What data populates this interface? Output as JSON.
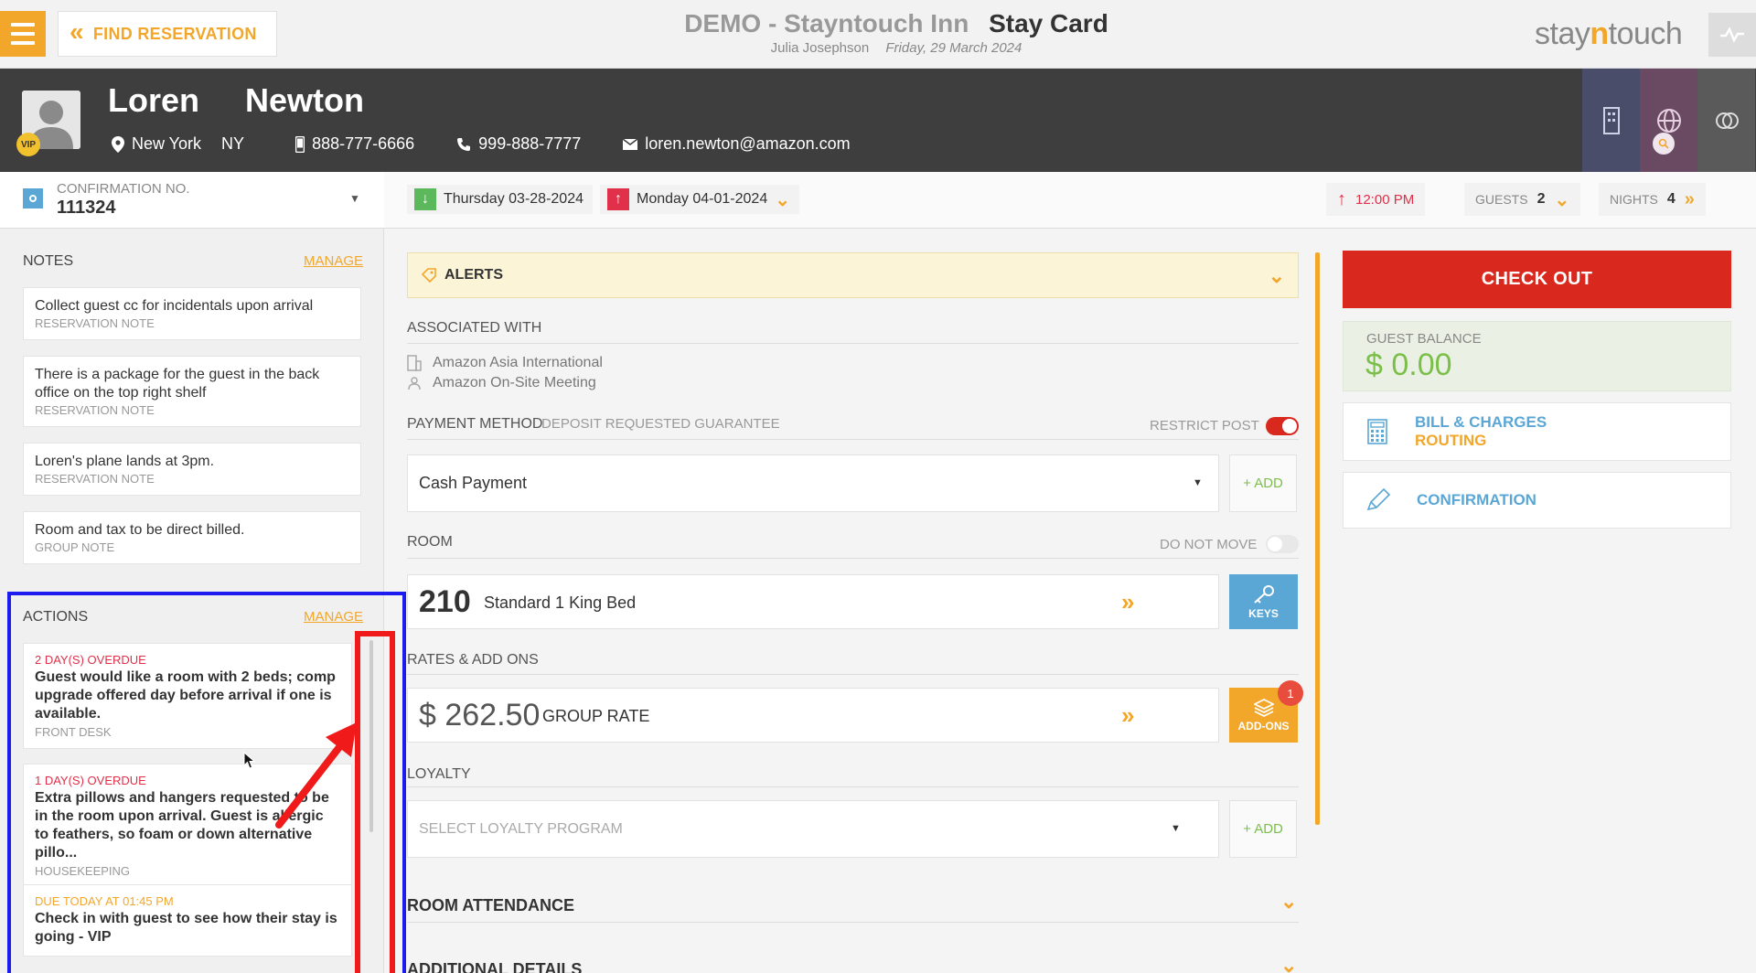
{
  "topbar": {
    "find_label": "FIND RESERVATION",
    "hotel_name": "DEMO - Stayntouch Inn",
    "page_title": "Stay Card",
    "user_name": "Julia Josephson",
    "business_date": "Friday, 29 March 2024",
    "logo_prefix": "stay",
    "logo_n": "n",
    "logo_suffix": "touch"
  },
  "guest": {
    "first_name": "Loren",
    "last_name": "Newton",
    "vip_label": "VIP",
    "city": "New York",
    "state": "NY",
    "mobile": "888-777-6666",
    "phone": "999-888-7777",
    "email": "loren.newton@amazon.com"
  },
  "reservation": {
    "confirmation_label": "CONFIRMATION NO.",
    "confirmation_number": "111324",
    "arrival": "Thursday 03-28-2024",
    "departure": "Monday 04-01-2024",
    "departure_time": "12:00 PM",
    "guests_label": "GUESTS",
    "guests": "2",
    "nights_label": "NIGHTS",
    "nights": "4"
  },
  "notes": {
    "title": "NOTES",
    "manage": "MANAGE",
    "items": [
      {
        "text": "Collect guest cc for incidentals upon arrival",
        "type": "RESERVATION NOTE"
      },
      {
        "text": "There is a package for the guest in the back office on the top right shelf",
        "type": "RESERVATION NOTE"
      },
      {
        "text": "Loren's plane lands at 3pm.",
        "type": "RESERVATION NOTE"
      },
      {
        "text": "Room and tax to be direct billed.",
        "type": "GROUP NOTE"
      }
    ]
  },
  "actions": {
    "title": "ACTIONS",
    "manage": "MANAGE",
    "items": [
      {
        "due": "2 DAY(S) OVERDUE",
        "text": "Guest would like a room with 2 beds; comp upgrade offered day before arrival if one is available.",
        "dept": "FRONT DESK"
      },
      {
        "due": "1 DAY(S) OVERDUE",
        "text": "Extra pillows and hangers requested to be in the room upon arrival. Guest is allergic to feathers, so foam or down alternative pillo...",
        "dept": "HOUSEKEEPING"
      },
      {
        "due": "DUE TODAY AT 01:45 PM",
        "text": "Check in with guest to see how their stay is going - VIP",
        "dept": ""
      }
    ]
  },
  "main": {
    "alerts_label": "ALERTS",
    "associated_label": "ASSOCIATED WITH",
    "company": "Amazon Asia International",
    "group": "Amazon On-Site Meeting",
    "payment_label": "PAYMENT METHOD",
    "payment_sub": "DEPOSIT REQUESTED GUARANTEE",
    "restrict_post": "RESTRICT POST",
    "payment_value": "Cash Payment",
    "add_label": "+ ADD",
    "room_label": "ROOM",
    "do_not_move": "DO NOT MOVE",
    "room_number": "210",
    "room_type": "Standard 1 King Bed",
    "keys_label": "KEYS",
    "rates_label": "RATES & ADD ONS",
    "rate_amount": "$ 262.50",
    "rate_name": "GROUP RATE",
    "addons_label": "ADD-ONS",
    "addons_count": "1",
    "loyalty_label": "LOYALTY",
    "loyalty_placeholder": "SELECT LOYALTY PROGRAM",
    "room_attendance": "ROOM ATTENDANCE",
    "additional_details": "ADDITIONAL DETAILS"
  },
  "right": {
    "checkout": "CHECK OUT",
    "balance_label": "GUEST BALANCE",
    "balance_value": "$ 0.00",
    "bill_label": "BILL & CHARGES",
    "routing_label": "ROUTING",
    "confirmation_label": "CONFIRMATION"
  },
  "colors": {
    "accent": "#f2a72b",
    "checkout": "#d9281e",
    "link": "#5aa7d6",
    "positive": "#7bbf4a"
  }
}
